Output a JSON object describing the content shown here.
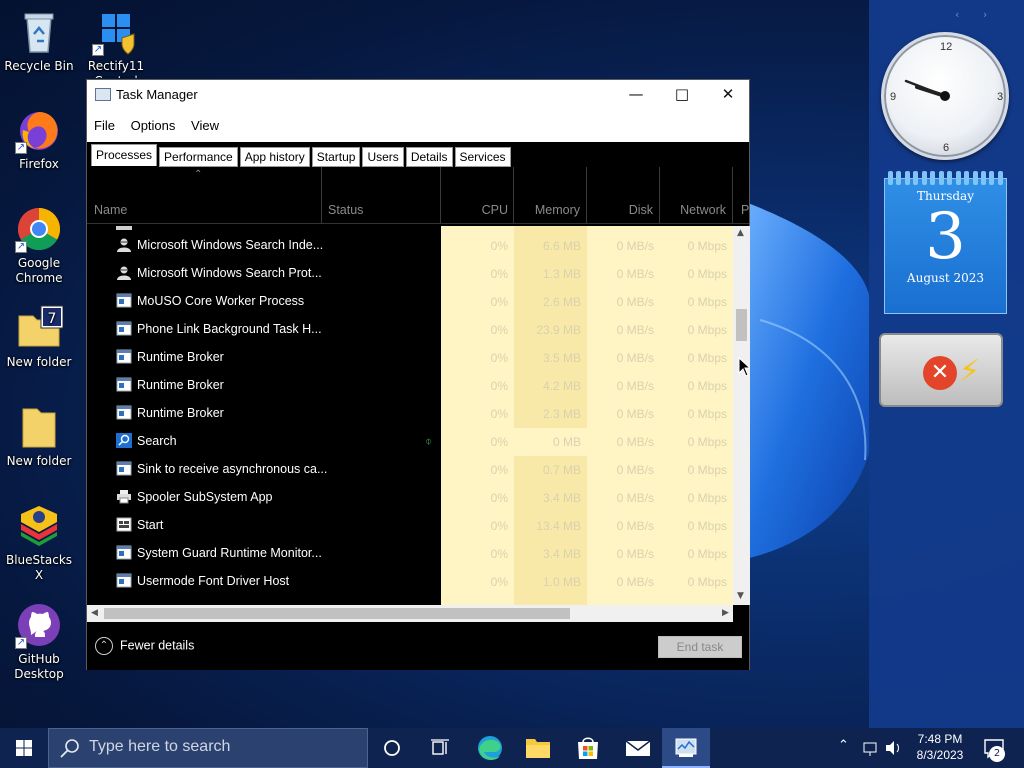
{
  "desktop": {
    "icons": [
      {
        "label": "Recycle Bin",
        "icon": "recycle-bin-icon"
      },
      {
        "label": "Rectify11 Control",
        "icon": "control-panel-icon"
      },
      {
        "label": "Firefox",
        "icon": "firefox-icon"
      },
      {
        "label": "Google Chrome",
        "icon": "chrome-icon"
      },
      {
        "label": "New folder",
        "icon": "folder-icon"
      },
      {
        "label": "New folder",
        "icon": "folder-icon"
      },
      {
        "label": "BlueStacks X",
        "icon": "bluestacks-icon"
      },
      {
        "label": "GitHub Desktop",
        "icon": "github-icon"
      }
    ]
  },
  "gadgets": {
    "clock": {
      "n12": "12",
      "n3": "3",
      "n6": "6",
      "n9": "9",
      "time_shown": "7:48"
    },
    "calendar": {
      "weekday": "Thursday",
      "day": "3",
      "month_year": "August 2023"
    },
    "battery": {
      "status": "no battery / charging",
      "colors": {
        "x": "#e2452a",
        "bolt": "#f4c419"
      }
    }
  },
  "task_manager": {
    "title": "Task Manager",
    "menu": [
      "File",
      "Options",
      "View"
    ],
    "tabs": [
      "Processes",
      "Performance",
      "App history",
      "Startup",
      "Users",
      "Details",
      "Services"
    ],
    "active_tab": "Processes",
    "columns": {
      "name": "Name",
      "status": "Status",
      "cpu": "CPU",
      "memory": "Memory",
      "disk": "Disk",
      "network": "Network",
      "power": "P"
    },
    "rows": [
      {
        "name": "Microsoft Windows Search Inde...",
        "icon": "search-indexer-icon",
        "cpu": "0%",
        "memory": "6.6 MB",
        "disk": "0 MB/s",
        "network": "0 Mbps"
      },
      {
        "name": "Microsoft Windows Search Prot...",
        "icon": "search-indexer-icon",
        "cpu": "0%",
        "memory": "1.3 MB",
        "disk": "0 MB/s",
        "network": "0 Mbps"
      },
      {
        "name": "MoUSO Core Worker Process",
        "icon": "process-icon",
        "cpu": "0%",
        "memory": "2.6 MB",
        "disk": "0 MB/s",
        "network": "0 Mbps"
      },
      {
        "name": "Phone Link Background Task H...",
        "icon": "process-icon",
        "cpu": "0%",
        "memory": "23.9 MB",
        "disk": "0 MB/s",
        "network": "0 Mbps"
      },
      {
        "name": "Runtime Broker",
        "icon": "process-icon",
        "cpu": "0%",
        "memory": "3.5 MB",
        "disk": "0 MB/s",
        "network": "0 Mbps"
      },
      {
        "name": "Runtime Broker",
        "icon": "process-icon",
        "cpu": "0%",
        "memory": "4.2 MB",
        "disk": "0 MB/s",
        "network": "0 Mbps"
      },
      {
        "name": "Runtime Broker",
        "icon": "process-icon",
        "cpu": "0%",
        "memory": "2.3 MB",
        "disk": "0 MB/s",
        "network": "0 Mbps"
      },
      {
        "name": "Search",
        "icon": "search-icon",
        "cpu": "0%",
        "memory": "0 MB",
        "disk": "0 MB/s",
        "network": "0 Mbps",
        "suspended": true
      },
      {
        "name": "Sink to receive asynchronous ca...",
        "icon": "process-icon",
        "cpu": "0%",
        "memory": "0.7 MB",
        "disk": "0 MB/s",
        "network": "0 Mbps"
      },
      {
        "name": "Spooler SubSystem App",
        "icon": "printer-icon",
        "cpu": "0%",
        "memory": "3.4 MB",
        "disk": "0 MB/s",
        "network": "0 Mbps"
      },
      {
        "name": "Start",
        "icon": "start-icon",
        "cpu": "0%",
        "memory": "13.4 MB",
        "disk": "0 MB/s",
        "network": "0 Mbps"
      },
      {
        "name": "System Guard Runtime Monitor...",
        "icon": "process-icon",
        "cpu": "0%",
        "memory": "3.4 MB",
        "disk": "0 MB/s",
        "network": "0 Mbps"
      },
      {
        "name": "Usermode Font Driver Host",
        "icon": "process-icon",
        "cpu": "0%",
        "memory": "1.0 MB",
        "disk": "0 MB/s",
        "network": "0 Mbps"
      }
    ],
    "footer": {
      "fewer_details": "Fewer details",
      "end_task": "End task"
    }
  },
  "taskbar": {
    "search_placeholder": "Type here to search",
    "pinned": [
      "cortana-icon",
      "task-view-icon",
      "edge-icon",
      "file-explorer-icon",
      "store-icon",
      "mail-icon",
      "task-manager-icon"
    ],
    "active": "task-manager-icon",
    "time": "7:48 PM",
    "date": "8/3/2023",
    "notifications": "2"
  },
  "colors": {
    "accent": "#0078d7",
    "heatmap_cell": "#fff4c4",
    "heatmap_cell_dark": "#f9e9a8"
  }
}
